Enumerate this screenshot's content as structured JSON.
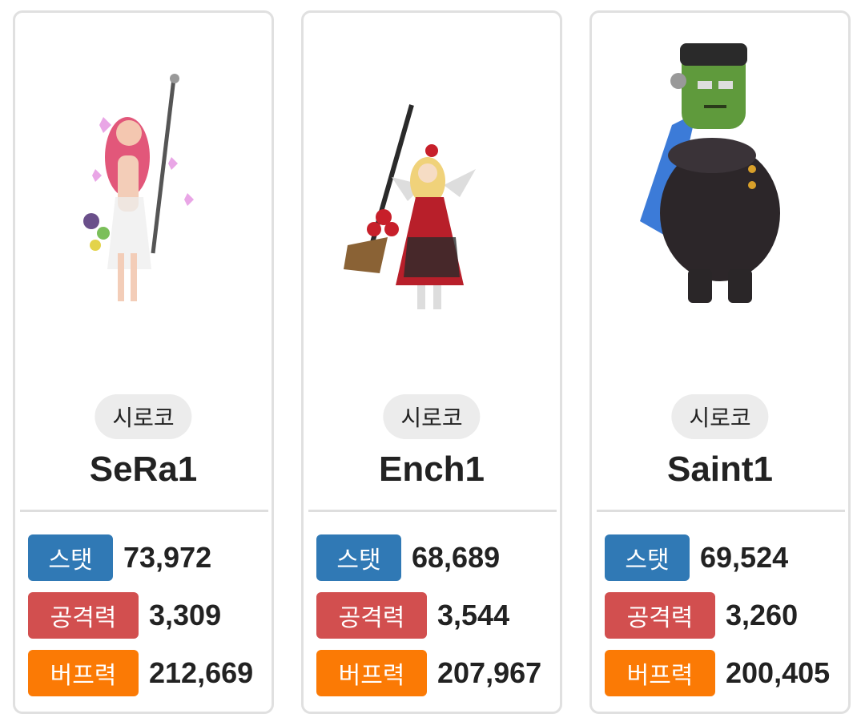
{
  "cards": [
    {
      "server": "시로코",
      "name": "SeRa1",
      "stats": [
        {
          "label": "스탯",
          "value": "73,972"
        },
        {
          "label": "공격력",
          "value": "3,309"
        },
        {
          "label": "버프력",
          "value": "212,669"
        }
      ]
    },
    {
      "server": "시로코",
      "name": "Ench1",
      "stats": [
        {
          "label": "스탯",
          "value": "68,689"
        },
        {
          "label": "공격력",
          "value": "3,544"
        },
        {
          "label": "버프력",
          "value": "207,967"
        }
      ]
    },
    {
      "server": "시로코",
      "name": "Saint1",
      "stats": [
        {
          "label": "스탯",
          "value": "69,524"
        },
        {
          "label": "공격력",
          "value": "3,260"
        },
        {
          "label": "버프력",
          "value": "200,405"
        }
      ]
    }
  ],
  "colors": {
    "stat_badge": "#3079b5",
    "attack_badge": "#d24f4f",
    "buff_badge": "#fb7a05"
  },
  "icons": [
    "character-avatar-sera",
    "character-avatar-enchantress",
    "character-avatar-saint"
  ]
}
